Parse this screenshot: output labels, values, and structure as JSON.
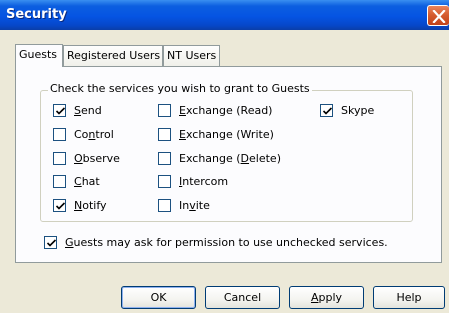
{
  "window": {
    "title": "Security"
  },
  "tabs": [
    {
      "label": "Guests",
      "active": true
    },
    {
      "label": "Registered Users",
      "active": false
    },
    {
      "label": "NT Users",
      "active": false
    }
  ],
  "group": {
    "legend": "Check the services you wish to grant to Guests"
  },
  "services": {
    "col1": [
      {
        "label_pre": "",
        "label_ul": "S",
        "label_post": "end",
        "checked": true
      },
      {
        "label_pre": "Co",
        "label_ul": "n",
        "label_post": "trol",
        "checked": false
      },
      {
        "label_pre": "",
        "label_ul": "O",
        "label_post": "bserve",
        "checked": false
      },
      {
        "label_pre": "",
        "label_ul": "C",
        "label_post": "hat",
        "checked": false
      },
      {
        "label_pre": "",
        "label_ul": "N",
        "label_post": "otify",
        "checked": true
      }
    ],
    "col2": [
      {
        "label_pre": "",
        "label_ul": "E",
        "label_post": "xchange (Read)",
        "checked": false
      },
      {
        "label_pre": "",
        "label_ul": "E",
        "label_post": "xchange (Write)",
        "checked": false
      },
      {
        "label_pre": "Exchange (",
        "label_ul": "D",
        "label_post": "elete)",
        "checked": false
      },
      {
        "label_pre": "",
        "label_ul": "I",
        "label_post": "ntercom",
        "checked": false
      },
      {
        "label_pre": "In",
        "label_ul": "v",
        "label_post": "ite",
        "checked": false
      }
    ],
    "col3": [
      {
        "label_pre": "",
        "label_ul": "",
        "label_post": "Skype",
        "checked": true
      }
    ]
  },
  "permission": {
    "label_pre": "",
    "label_ul": "G",
    "label_post": "uests may ask for permission to use unchecked services.",
    "checked": true
  },
  "buttons": {
    "ok": "OK",
    "cancel": "Cancel",
    "apply_ul": "A",
    "apply_post": "pply",
    "help": "Help"
  },
  "colors": {
    "titlebar": "#0554e3",
    "close": "#c1421a",
    "dialog_bg": "#ece9d8",
    "panel_bg": "#fcfcfe",
    "checkbox_border": "#1c5180",
    "tick": "#21a121"
  }
}
